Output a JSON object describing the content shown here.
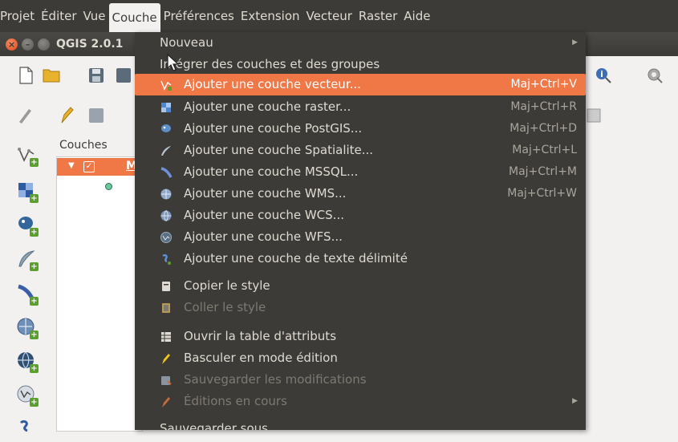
{
  "menubar": {
    "items": [
      "Projet",
      "Éditer",
      "Vue",
      "Couche",
      "Préférences",
      "Extension",
      "Vecteur",
      "Raster",
      "Aide"
    ],
    "active": "Couche"
  },
  "window": {
    "title": "QGIS 2.0.1"
  },
  "layers_panel": {
    "title": "Couches",
    "layer_name": "M"
  },
  "dropdown": {
    "items": [
      {
        "label": "Nouveau",
        "submenu": true
      },
      {
        "label": "Intégrer des couches et des groupes"
      },
      {
        "label": "Ajouter une couche vecteur...",
        "shortcut": "Maj+Ctrl+V",
        "icon": "vector-layer-icon",
        "highlight": true
      },
      {
        "label": "Ajouter une couche raster...",
        "shortcut": "Maj+Ctrl+R",
        "icon": "raster-layer-icon"
      },
      {
        "label": "Ajouter une couche PostGIS...",
        "shortcut": "Maj+Ctrl+D",
        "icon": "postgis-icon"
      },
      {
        "label": "Ajouter une couche Spatialite...",
        "shortcut": "Maj+Ctrl+L",
        "icon": "spatialite-icon"
      },
      {
        "label": "Ajouter une couche MSSQL...",
        "shortcut": "Maj+Ctrl+M",
        "icon": "mssql-icon"
      },
      {
        "label": "Ajouter une couche WMS...",
        "shortcut": "Maj+Ctrl+W",
        "icon": "wms-icon"
      },
      {
        "label": "Ajouter une couche WCS...",
        "icon": "wcs-icon"
      },
      {
        "label": "Ajouter une couche WFS...",
        "icon": "wfs-icon"
      },
      {
        "label": "Ajouter une couche de texte délimité",
        "icon": "delimited-text-icon"
      },
      {
        "label": "Copier le style",
        "icon": "copy-style-icon"
      },
      {
        "label": "Coller le style",
        "icon": "paste-style-icon",
        "disabled": true
      },
      {
        "label": "Ouvrir la table d'attributs",
        "icon": "attribute-table-icon"
      },
      {
        "label": "Basculer en mode édition",
        "icon": "pencil-icon"
      },
      {
        "label": "Sauvegarder les modifications",
        "icon": "save-edits-icon",
        "disabled": true
      },
      {
        "label": "Éditions en cours",
        "icon": "current-edits-icon",
        "disabled": true,
        "submenu": true
      },
      {
        "label": "Sauvegarder sous..."
      }
    ]
  },
  "colors": {
    "highlight": "#f07746",
    "menu_bg": "#3c3b37",
    "menu_text": "#dfdbd2",
    "disabled_text": "#7d7a72"
  }
}
